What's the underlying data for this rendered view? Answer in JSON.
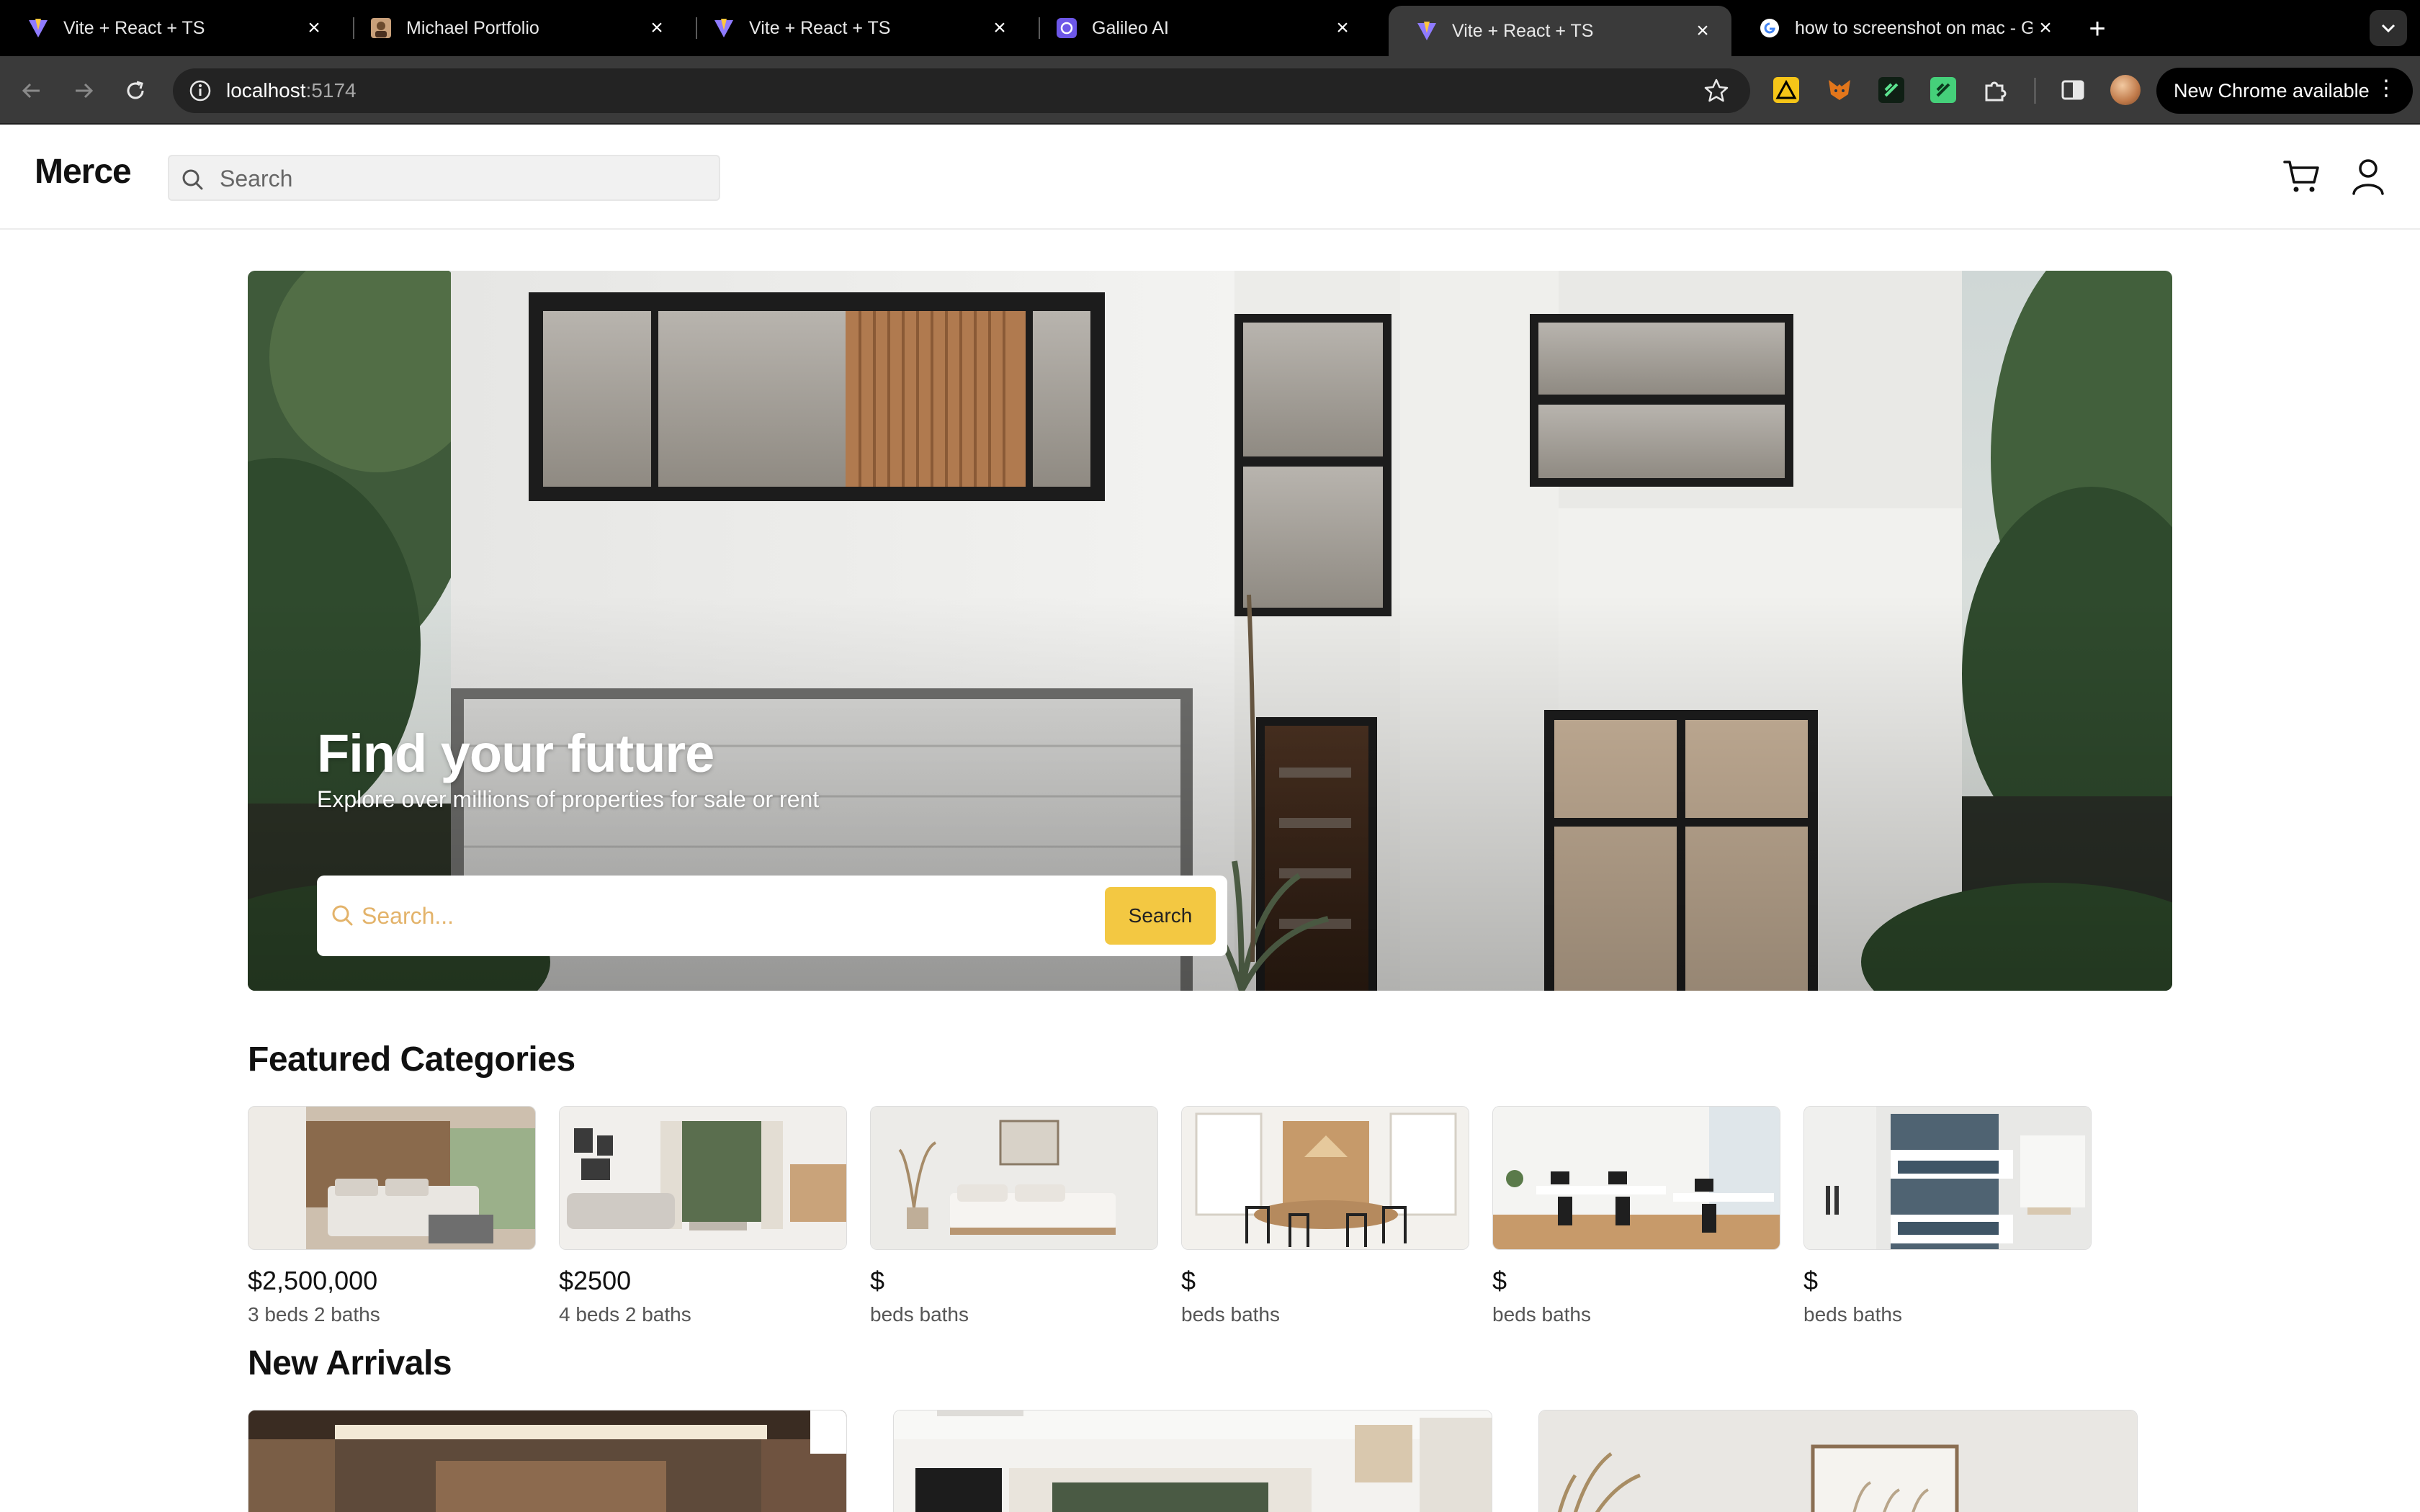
{
  "browser": {
    "tabs": [
      {
        "title": "Vite + React + TS",
        "favicon": "vite-icon",
        "active": false
      },
      {
        "title": "Michael Portfolio",
        "favicon": "portfolio-icon",
        "active": false
      },
      {
        "title": "Vite + React + TS",
        "favicon": "vite-icon",
        "active": false
      },
      {
        "title": "Galileo AI",
        "favicon": "galileo-icon",
        "active": false
      },
      {
        "title": "Vite + React + TS",
        "favicon": "vite-icon",
        "active": true
      },
      {
        "title": "how to screenshot on mac - G",
        "favicon": "google-icon",
        "active": false
      }
    ],
    "address": {
      "host": "localhost",
      "port": ":5174"
    },
    "update_label": "New Chrome available",
    "colors": {
      "frame": "#000000",
      "toolbar": "#3a3a3a",
      "omnibox": "#232323"
    }
  },
  "app": {
    "logo": "Merce",
    "search_placeholder": "Search"
  },
  "hero": {
    "title": "Find your future",
    "subtitle": "Explore over millions of properties for sale or rent",
    "search_placeholder": "Search...",
    "search_button": "Search",
    "accent": "#f3c842"
  },
  "featured": {
    "title": "Featured Categories",
    "items": [
      {
        "price": "$2,500,000",
        "meta": "3 beds 2 baths",
        "image": "bedroom-photo"
      },
      {
        "price": "$2500",
        "meta": "4 beds 2 baths",
        "image": "living-room-photo"
      },
      {
        "price": "$",
        "meta": "beds baths",
        "image": "minimal-bedroom-photo"
      },
      {
        "price": "$",
        "meta": "beds baths",
        "image": "dining-room-photo"
      },
      {
        "price": "$",
        "meta": "beds baths",
        "image": "office-photo"
      },
      {
        "price": "$",
        "meta": "beds baths",
        "image": "bunk-bedroom-photo"
      }
    ]
  },
  "arrivals": {
    "title": "New Arrivals",
    "items": [
      {
        "image": "hallway-photo"
      },
      {
        "image": "kitchen-photo"
      },
      {
        "image": "bedroom-wall-photo"
      }
    ]
  }
}
